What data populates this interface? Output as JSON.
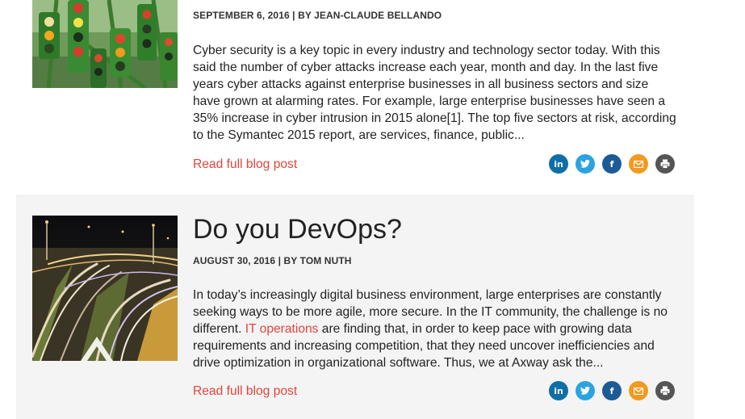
{
  "posts": [
    {
      "title": "",
      "meta": "SEPTEMBER 6, 2016 | BY JEAN-CLAUDE BELLANDO",
      "excerpt": "Cyber security is a key topic in every industry and technology sector today. With this said the number of cyber attacks increase each year, month and day. In the last five years cyber attacks against enterprise businesses in all business sectors and size have grown at alarming rates. For example, large enterprise businesses have seen a 35% increase in cyber intrusion in 2015 alone[1].  The top five sectors at risk, according to the Symantec 2015 report, are services, finance, public...",
      "read_more": "Read full blog post",
      "image_icon": "traffic-lights-image"
    },
    {
      "title": "Do you DevOps?",
      "meta": "AUGUST 30, 2016 | BY TOM NUTH",
      "excerpt_before": "In today’s increasingly digital business environment, large enterprises are constantly seeking ways to be more agile, more secure. In the IT community, the challenge is no different. ",
      "excerpt_link": "IT operations",
      "excerpt_after": " are finding that, in order to keep pace with growing data requirements and increasing competition, that they need uncover inefficiencies and drive optimization in organizational software. Thus, we at Axway ask the...",
      "read_more": "Read full blog post",
      "image_icon": "highway-night-image"
    }
  ],
  "share": {
    "icons": [
      "linkedin-icon",
      "twitter-icon",
      "facebook-icon",
      "email-icon",
      "print-icon"
    ],
    "linkedin_glyph": "in",
    "facebook_glyph": "f"
  },
  "colors": {
    "accent": "#e0443a",
    "linkedin": "#0e6fa6",
    "twitter": "#2ba3e0",
    "facebook": "#1c5b96",
    "email": "#f29a1f",
    "print": "#555555"
  }
}
